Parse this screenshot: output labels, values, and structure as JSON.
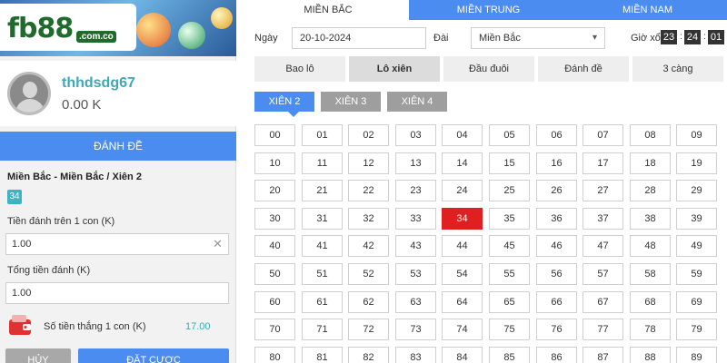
{
  "brand": {
    "logo_text": "fb88",
    "logo_domain": ".com.co"
  },
  "user": {
    "username": "thhdsdg67",
    "balance": "0.00 K"
  },
  "left": {
    "danh_de_label": "ĐÁNH ĐỀ",
    "bet_title": "Miền Bắc - Miền Bắc / Xiên 2",
    "selected_chip": "34",
    "per_label": "Tiền đánh trên 1 con (K)",
    "per_value": "1.00",
    "total_label": "Tổng tiền đánh (K)",
    "total_value": "1.00",
    "win_label": "Số tiền thắng 1 con (K)",
    "win_value": "17.00",
    "cancel_label": "HỦY",
    "place_label": "ĐẶT CƯỢC"
  },
  "regions": [
    {
      "label": "MIỀN BẮC",
      "active": true
    },
    {
      "label": "MIỀN TRUNG",
      "active": false
    },
    {
      "label": "MIỀN NAM",
      "active": false
    }
  ],
  "filters": {
    "date_label": "Ngày",
    "date_value": "20-10-2024",
    "dai_label": "Đài",
    "dai_value": "Miền Bắc",
    "gio_label": "Giờ xổ",
    "time": [
      "23",
      "24",
      "01"
    ]
  },
  "bet_types": [
    {
      "label": "Bao lô",
      "active": false
    },
    {
      "label": "Lô xiên",
      "active": true
    },
    {
      "label": "Đầu đuôi",
      "active": false
    },
    {
      "label": "Đánh đề",
      "active": false
    },
    {
      "label": "3 càng",
      "active": false
    }
  ],
  "xien_tabs": [
    {
      "label": "XIÊN 2",
      "active": true
    },
    {
      "label": "XIÊN 3",
      "active": false
    },
    {
      "label": "XIÊN 4",
      "active": false
    }
  ],
  "numbers": {
    "values": [
      "00",
      "01",
      "02",
      "03",
      "04",
      "05",
      "06",
      "07",
      "08",
      "09",
      "10",
      "11",
      "12",
      "13",
      "14",
      "15",
      "16",
      "17",
      "18",
      "19",
      "20",
      "21",
      "22",
      "23",
      "24",
      "25",
      "26",
      "27",
      "28",
      "29",
      "30",
      "31",
      "32",
      "33",
      "34",
      "35",
      "36",
      "37",
      "38",
      "39",
      "40",
      "41",
      "42",
      "43",
      "44",
      "45",
      "46",
      "47",
      "48",
      "49",
      "50",
      "51",
      "52",
      "53",
      "54",
      "55",
      "56",
      "57",
      "58",
      "59",
      "60",
      "61",
      "62",
      "63",
      "64",
      "65",
      "66",
      "67",
      "68",
      "69",
      "70",
      "71",
      "72",
      "73",
      "74",
      "75",
      "76",
      "77",
      "78",
      "79",
      "80",
      "81",
      "82",
      "83",
      "84",
      "85",
      "86",
      "87",
      "88",
      "89"
    ],
    "selected": [
      "34"
    ]
  },
  "colors": {
    "accent": "#4a8cf0",
    "selected": "#e02020",
    "teal": "#3fa7b5"
  },
  "icons": {
    "avatar": "user-silhouette",
    "wallet": "wallet-icon",
    "clear": "close-icon",
    "select": "chevron-down-icon"
  }
}
